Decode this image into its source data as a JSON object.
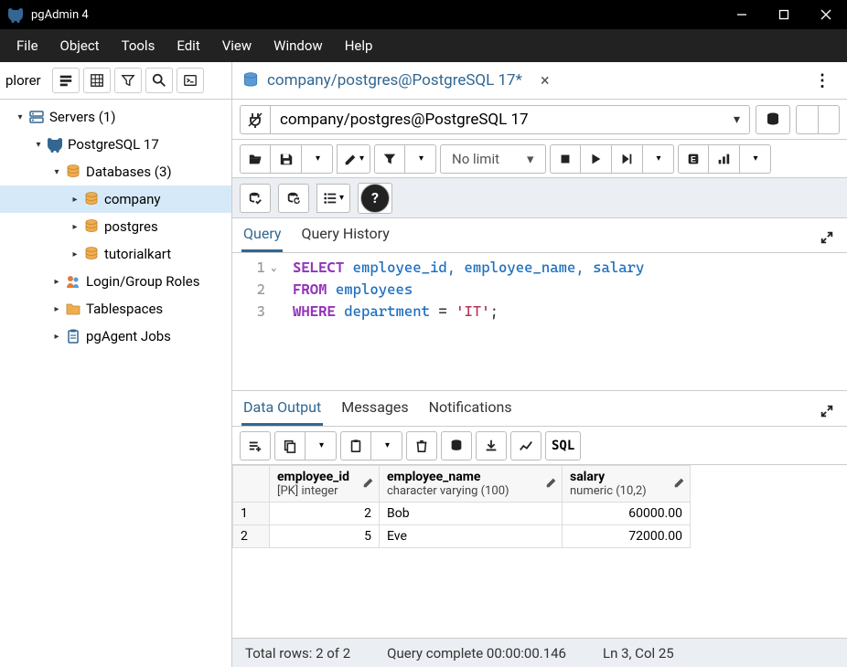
{
  "window": {
    "title": "pgAdmin 4"
  },
  "menubar": [
    "File",
    "Object",
    "Tools",
    "Edit",
    "View",
    "Window",
    "Help"
  ],
  "sidebar": {
    "title": "plorer",
    "tree": {
      "servers": {
        "label": "Servers (1)"
      },
      "pg17": {
        "label": "PostgreSQL 17"
      },
      "databases": {
        "label": "Databases (3)"
      },
      "db_company": {
        "label": "company"
      },
      "db_postgres": {
        "label": "postgres"
      },
      "db_tutorialkart": {
        "label": "tutorialkart"
      },
      "login_roles": {
        "label": "Login/Group Roles"
      },
      "tablespaces": {
        "label": "Tablespaces"
      },
      "pgagent": {
        "label": "pgAgent Jobs"
      }
    }
  },
  "tab": {
    "title": "company/postgres@PostgreSQL 17*"
  },
  "connection": {
    "value": "company/postgres@PostgreSQL 17"
  },
  "toolbar": {
    "limit": "No limit"
  },
  "editor_tabs": {
    "query": "Query",
    "history": "Query History"
  },
  "editor": {
    "lines": [
      "1",
      "2",
      "3"
    ]
  },
  "sql": {
    "select": "SELECT",
    "from": "FROM",
    "where": "WHERE",
    "cols": " employee_id, employee_name, salary",
    "table": " employees",
    "cond_col": " department ",
    "eq": "= ",
    "lit": "'IT'",
    "semi": ";"
  },
  "output_tabs": {
    "data": "Data Output",
    "messages": "Messages",
    "notifications": "Notifications"
  },
  "output_toolbar": {
    "sql": "SQL"
  },
  "columns": [
    {
      "name": "employee_id",
      "type": "[PK] integer"
    },
    {
      "name": "employee_name",
      "type": "character varying (100)"
    },
    {
      "name": "salary",
      "type": "numeric (10,2)"
    }
  ],
  "rows": [
    {
      "n": "1",
      "employee_id": "2",
      "employee_name": "Bob",
      "salary": "60000.00"
    },
    {
      "n": "2",
      "employee_id": "5",
      "employee_name": "Eve",
      "salary": "72000.00"
    }
  ],
  "status": {
    "rows": "Total rows: 2 of 2",
    "time": "Query complete 00:00:00.146",
    "pos": "Ln 3, Col 25"
  }
}
